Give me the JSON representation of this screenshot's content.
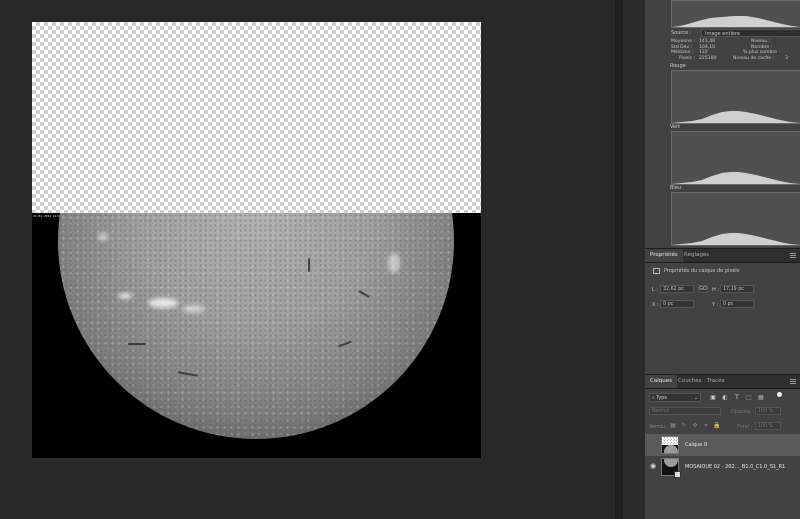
{
  "canvas": {
    "timestamp_label": "22.04.2024 10:03 UTC"
  },
  "histogram": {
    "source_label": "Source :",
    "source_value": "Image entière",
    "stats": {
      "moyenne_label": "Moyenne :",
      "moyenne_value": "141,48",
      "stddev_label": "Std Dev :",
      "stddev_value": "104,10",
      "mediane_label": "Médiane :",
      "mediane_value": "122",
      "pixels_label": "Pixels :",
      "pixels_value": "225180",
      "niveau_label": "Niveau :",
      "nombre_label": "Nombre :",
      "plus_sombre_label": "% plus sombre :",
      "cache_label": "Niveau de cache :",
      "cache_value": "3"
    },
    "channels": [
      "Rouge",
      "Vert",
      "Bleu"
    ]
  },
  "properties_panel": {
    "tabs": [
      "Propriétés",
      "Réglages"
    ],
    "active_tab": "Propriétés",
    "title": "Propriétés du calque de pixels",
    "L_label": "L :",
    "L_value": "32,62 pc",
    "link_label": "GO",
    "H_label": "H :",
    "H_value": "17,19 pc",
    "X_label": "X :",
    "X_value": "0 pc",
    "Y_label": "Y :",
    "Y_value": "0 pc"
  },
  "layers_panel": {
    "tabs": [
      "Calques",
      "Couches",
      "Tracés"
    ],
    "active_tab": "Calques",
    "filter_value": "Type",
    "blend_mode": "Normal",
    "opacity_label": "Opacité :",
    "opacity_value": "100 %",
    "lock_label": "Verrou :",
    "fill_label": "Fond :",
    "fill_value": "100 %",
    "layers": [
      {
        "name": "Calque 0",
        "selected": true,
        "visible": false
      },
      {
        "name": "MOSAIQUE 02 - 202..._B1.0_C1.0_S1_R1",
        "selected": false,
        "visible": true
      }
    ]
  },
  "colors": {
    "canvas_bg": "#282828",
    "panel_bg": "#424242",
    "selected_layer": "#5a5a5a"
  }
}
